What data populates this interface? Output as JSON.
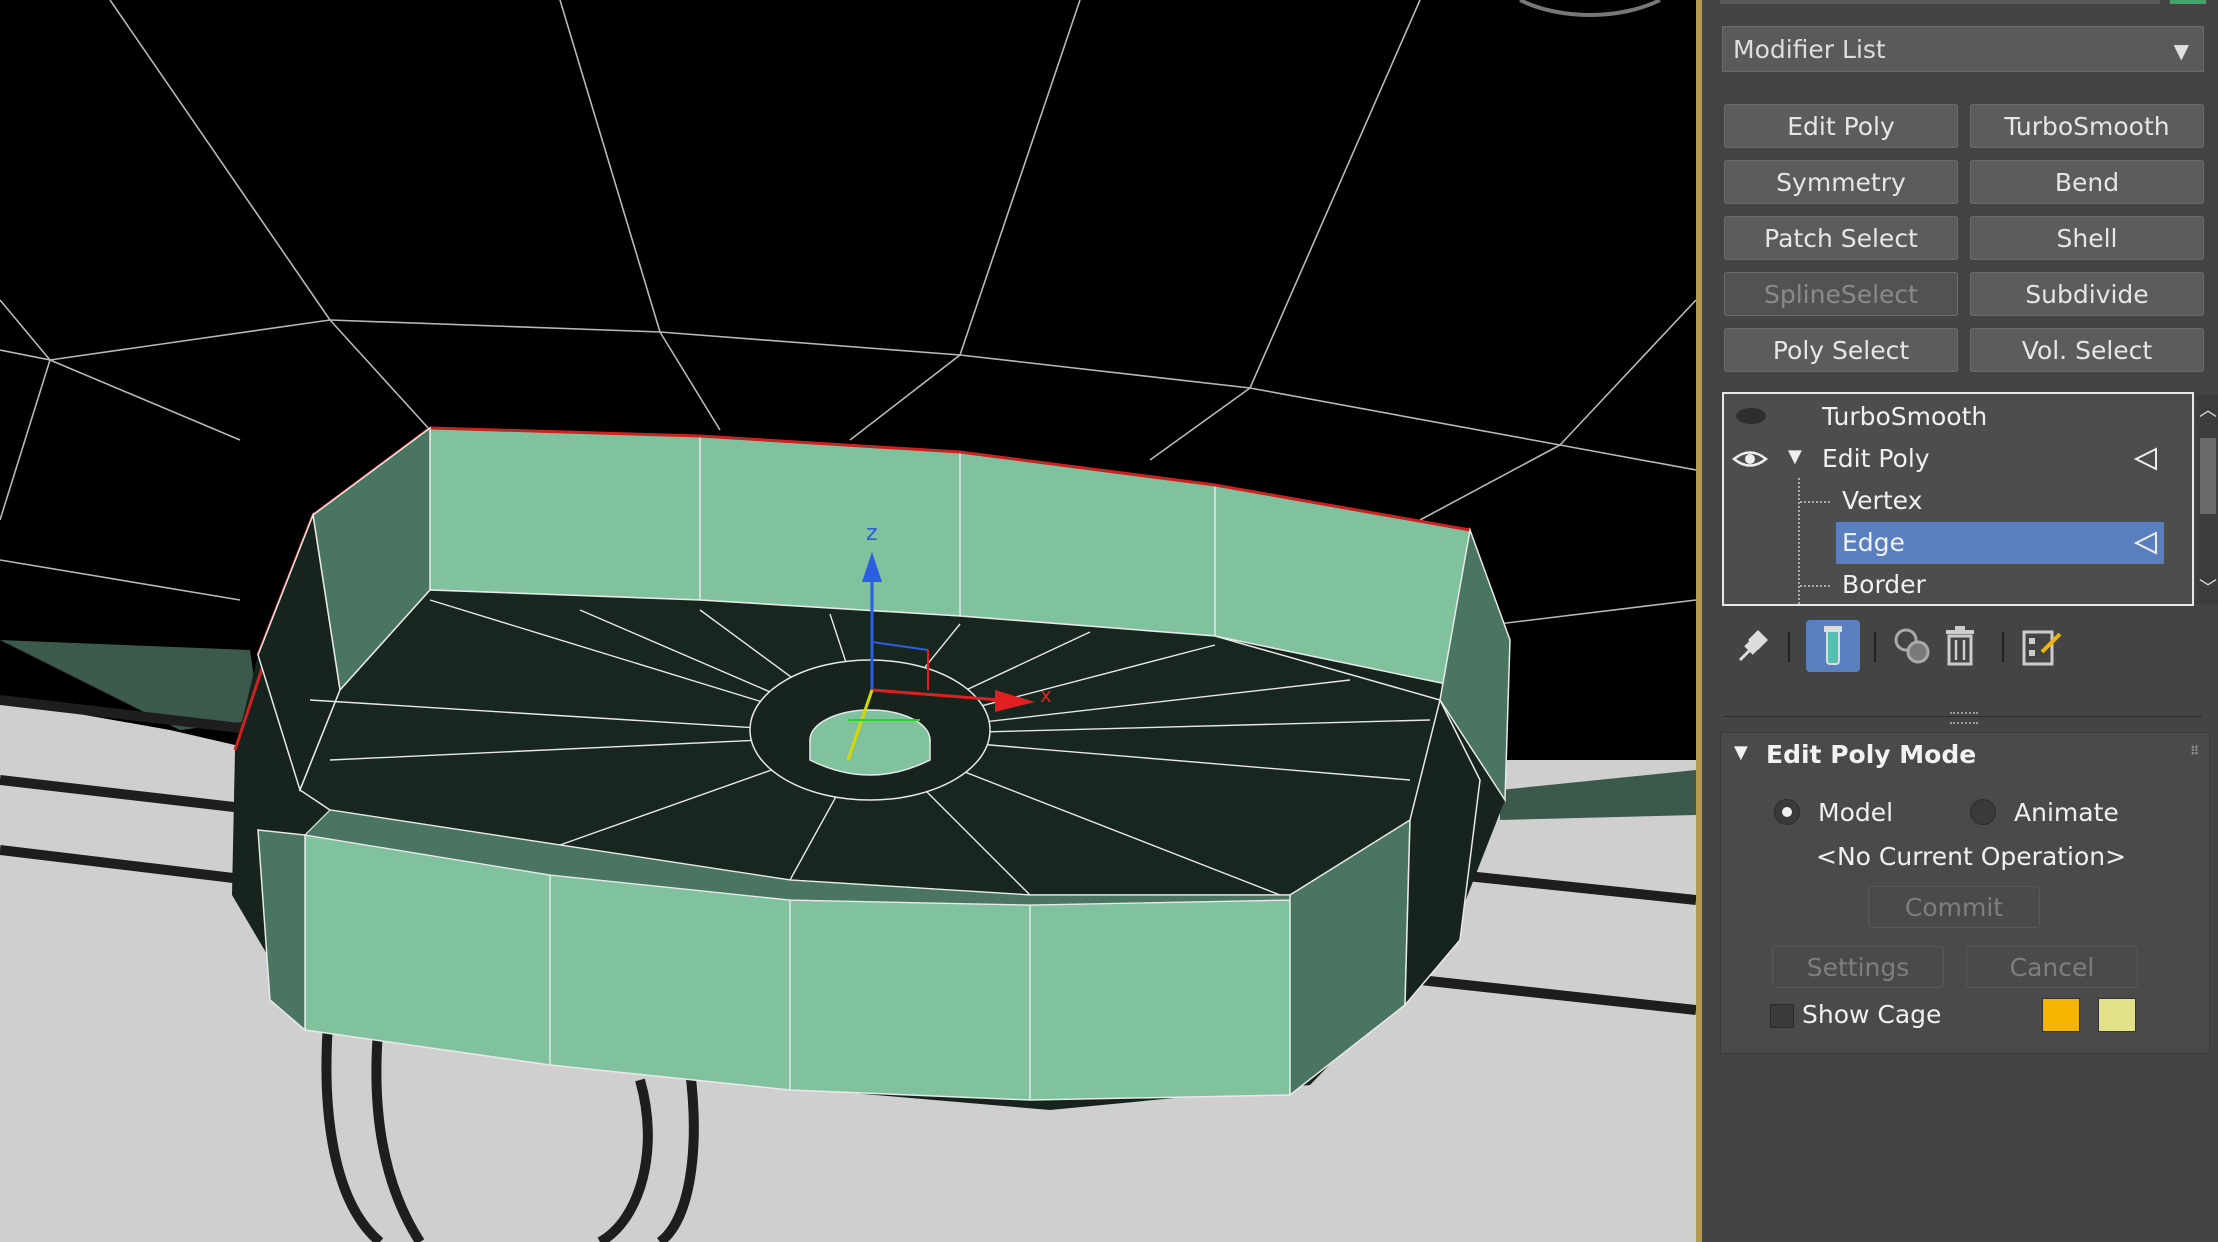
{
  "viewport": {
    "gizmo_axes": {
      "z": "z",
      "x": "x"
    },
    "colors": {
      "mesh_face": "#80c19e",
      "mesh_face_shadow": "#4a7560",
      "mesh_dark": "#16241d",
      "background": "#000000",
      "ground": "#cfcfcf"
    }
  },
  "panel": {
    "modifier_list_label": "Modifier List",
    "modifier_buttons": [
      {
        "label": "Edit Poly",
        "enabled": true
      },
      {
        "label": "TurboSmooth",
        "enabled": true
      },
      {
        "label": "Symmetry",
        "enabled": true
      },
      {
        "label": "Bend",
        "enabled": true
      },
      {
        "label": "Patch Select",
        "enabled": true
      },
      {
        "label": "Shell",
        "enabled": true
      },
      {
        "label": "SplineSelect",
        "enabled": false
      },
      {
        "label": "Subdivide",
        "enabled": true
      },
      {
        "label": "Poly Select",
        "enabled": true
      },
      {
        "label": "Vol. Select",
        "enabled": true
      }
    ],
    "stack": {
      "items": [
        {
          "label": "TurboSmooth",
          "level": 0
        },
        {
          "label": "Edit Poly",
          "level": 0
        },
        {
          "label": "Vertex",
          "level": 1
        },
        {
          "label": "Edge",
          "level": 1,
          "selected": true
        },
        {
          "label": "Border",
          "level": 1
        }
      ]
    },
    "toolbar_icons": [
      "pin-stack-icon",
      "show-end-result-icon",
      "make-unique-icon",
      "remove-modifier-icon",
      "configure-modifier-sets-icon"
    ],
    "edit_poly_mode": {
      "title": "Edit Poly Mode",
      "model_label": "Model",
      "animate_label": "Animate",
      "selected_mode": "Model",
      "current_operation": "<No Current Operation>",
      "commit_label": "Commit",
      "settings_label": "Settings",
      "cancel_label": "Cancel",
      "show_cage_label": "Show Cage",
      "show_cage_checked": false,
      "cage_colors": [
        "#f5b400",
        "#e3e08a"
      ]
    },
    "accent_color": "#5a7fbe"
  }
}
